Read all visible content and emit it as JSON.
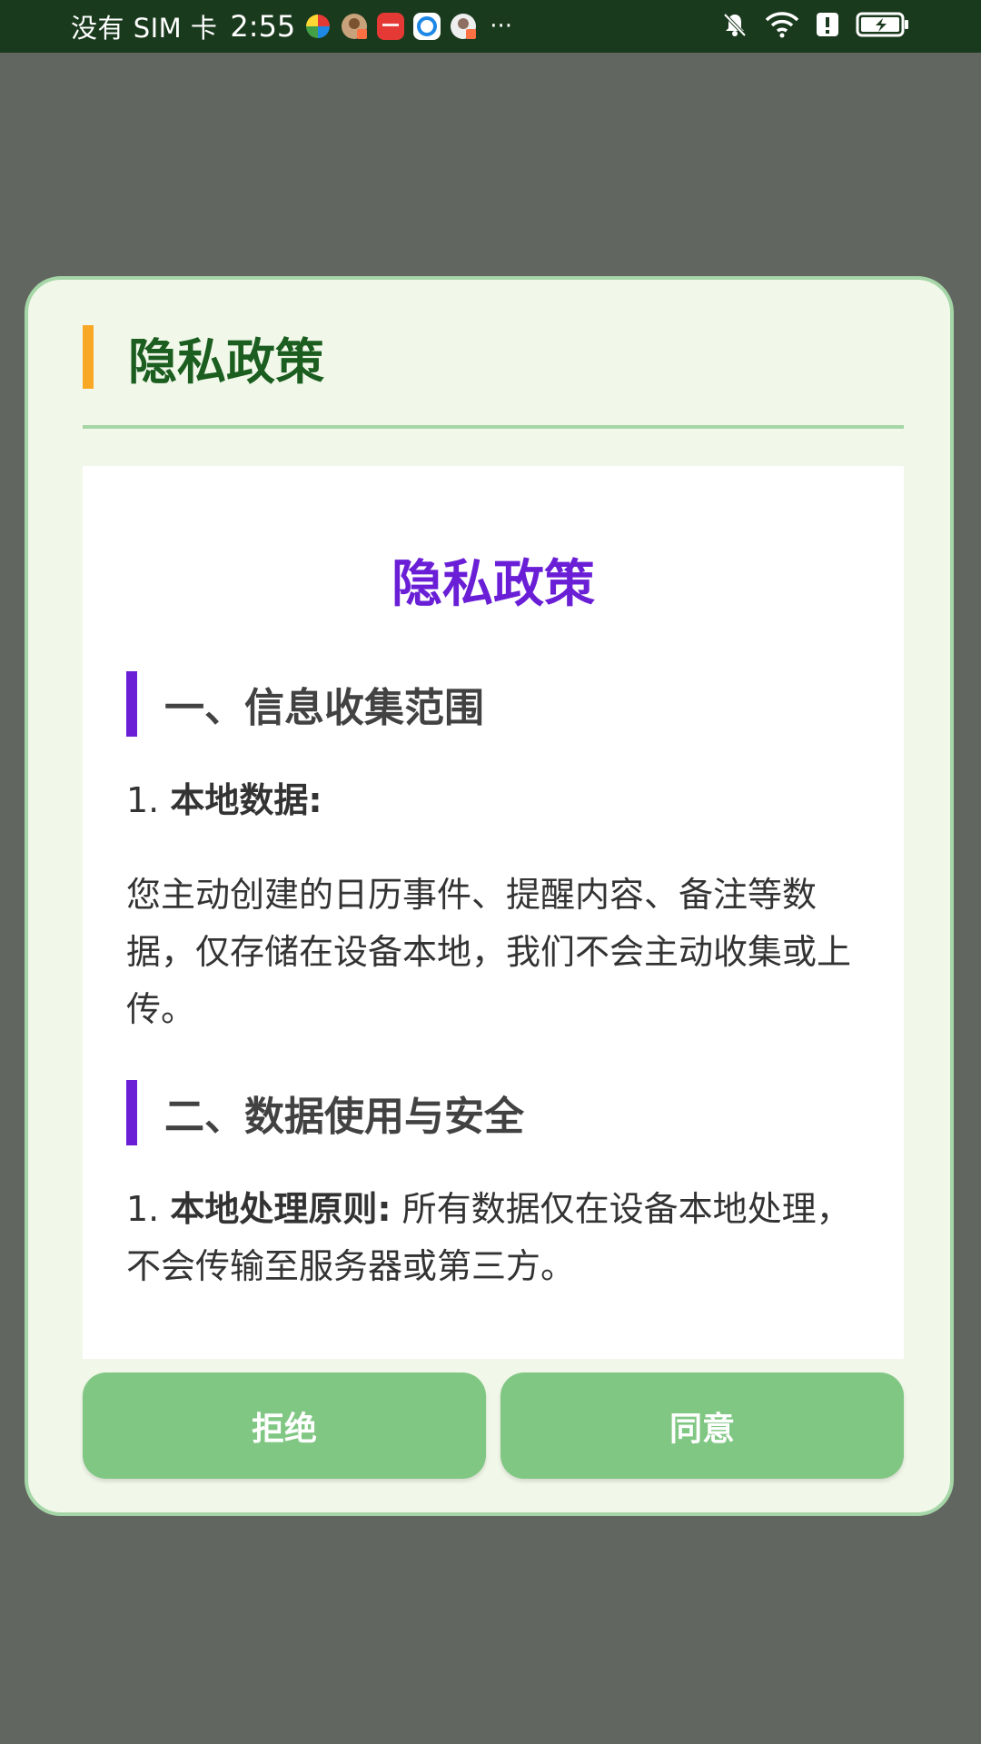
{
  "status_bar": {
    "carrier": "没有 SIM 卡",
    "time": "2:55",
    "more": "···",
    "app_icons": [
      "pinwheel-app-icon",
      "avatar-app-icon",
      "huawei-store-icon",
      "browser-app-icon",
      "avatar-app-icon-2"
    ],
    "right_icons": [
      "bell-off-icon",
      "wifi-icon",
      "alert-icon",
      "battery-charging-icon"
    ]
  },
  "dialog": {
    "title": "隐私政策",
    "content": {
      "doc_title": "隐私政策",
      "section1": {
        "heading": "一、信息收集范围",
        "item1_num": "1.",
        "item1_label": "本地数据:",
        "item1_body": "您主动创建的日历事件、提醒内容、备注等数据，仅存储在设备本地，我们不会主动收集或上传。"
      },
      "section2": {
        "heading": "二、数据使用与安全",
        "item1_num": "1.",
        "item1_label": "本地处理原则:",
        "item1_body": "所有数据仅在设备本地处理，不会传输至服务器或第三方。"
      }
    },
    "buttons": {
      "reject": "拒绝",
      "agree": "同意"
    }
  },
  "colors": {
    "overlay": "#626660",
    "status_bar": "#1a3a1d",
    "dialog_bg": "#f1f8e9",
    "dialog_border": "#a5d6a7",
    "title_accent": "#f9a825",
    "title_text": "#1b5e20",
    "doc_accent": "#6a1fd6",
    "button": "#81c784"
  }
}
